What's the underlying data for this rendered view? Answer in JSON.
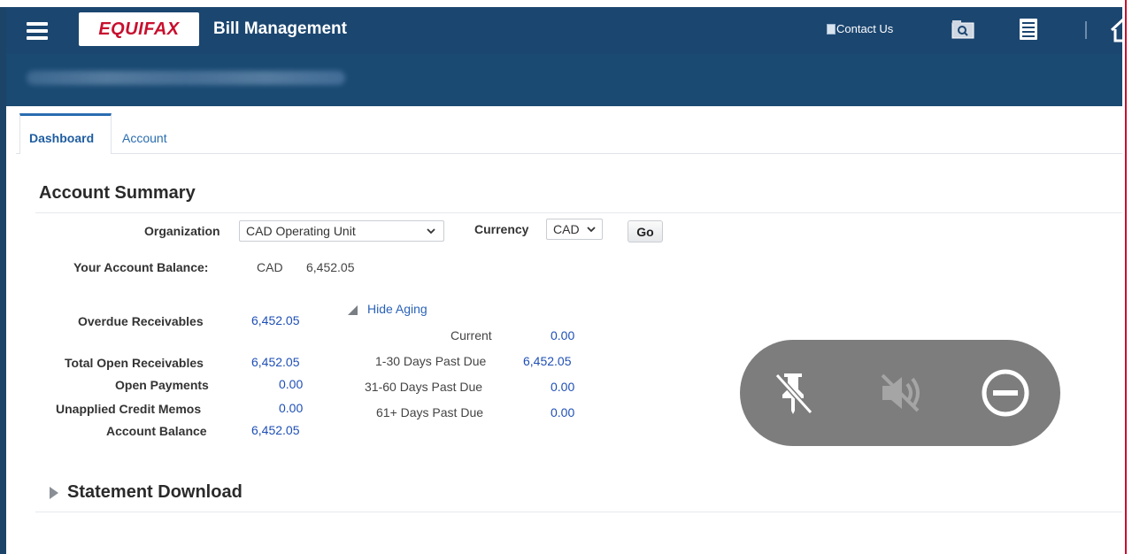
{
  "header": {
    "logo_text": "EQUIFAX",
    "app_title": "Bill Management",
    "contact_label": "Contact Us",
    "search_icon": "search-icon",
    "menu_icon": "hamburger-menu-icon",
    "list_icon": "document-list-icon",
    "home_icon": "home-icon"
  },
  "tabs": [
    {
      "label": "Dashboard",
      "active": true
    },
    {
      "label": "Account",
      "active": false
    }
  ],
  "account_summary": {
    "title": "Account Summary",
    "organization_label": "Organization",
    "organization_value": "CAD Operating Unit",
    "currency_label": "Currency",
    "currency_value": "CAD",
    "go_label": "Go",
    "balance_label": "Your Account Balance:",
    "balance_currency": "CAD",
    "balance_amount": "6,452.05",
    "receivables": [
      {
        "label": "Overdue Receivables",
        "value": "6,452.05"
      },
      {
        "label": "Total Open Receivables",
        "value": "6,452.05"
      },
      {
        "label": "Open Payments",
        "value": "0.00"
      },
      {
        "label": "Unapplied Credit Memos",
        "value": "0.00"
      },
      {
        "label": "Account Balance",
        "value": "6,452.05"
      }
    ],
    "aging_toggle": "Hide Aging",
    "aging": [
      {
        "label": "Current",
        "value": "0.00"
      },
      {
        "label": "1-30 Days Past Due",
        "value": "6,452.05"
      },
      {
        "label": "31-60 Days Past Due",
        "value": "0.00"
      },
      {
        "label": "61+ Days Past Due",
        "value": "0.00"
      }
    ]
  },
  "statement_download": {
    "title": "Statement Download"
  },
  "overlay": {
    "icons": [
      "pin-off-icon",
      "volume-off-icon",
      "minus-circle-icon"
    ]
  },
  "colors": {
    "header_bg": "#1a4a72",
    "link_blue": "#1f4fb6",
    "tab_active": "#2a6db0",
    "overlay_bg": "#7d7d7d",
    "brand_red": "#c8102e"
  }
}
